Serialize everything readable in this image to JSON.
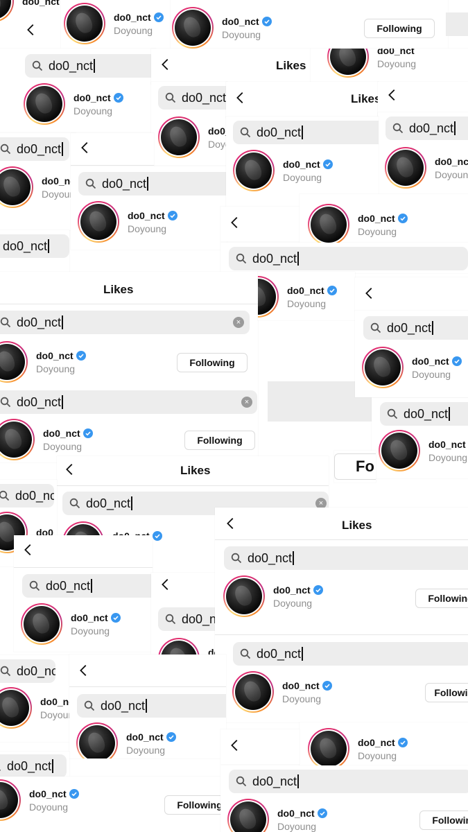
{
  "header": {
    "title": "Likes"
  },
  "search": {
    "query": "do0_nct"
  },
  "account": {
    "username": "do0_nct",
    "full_name": "Doyoung",
    "verified": true
  },
  "actions": {
    "following_label": "Following",
    "partial_follow_label": "Fo"
  },
  "icons": {
    "back": "chevron-left-icon",
    "search": "search-icon",
    "clear": "clear-icon",
    "verified": "verified-badge-icon"
  },
  "colors": {
    "verified_blue": "#3897f0",
    "search_bg": "#ededed",
    "button_border": "#dbdbdb",
    "secondary_text": "#8e8e8e",
    "story_ring": "#e1306c"
  }
}
